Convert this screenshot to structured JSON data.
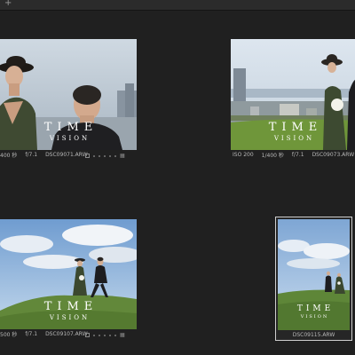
{
  "toolbar": {
    "add_icon": "plus-icon"
  },
  "watermark": {
    "title": "TIME",
    "subtitle": "VISION"
  },
  "thumbnails": [
    {
      "iso": "",
      "shutter": "400 秒",
      "aperture": "f/7.1",
      "filename": "DSC09071.ARW"
    },
    {
      "iso": "ISO 200",
      "shutter": "1/400 秒",
      "aperture": "f/7.1",
      "filename": "DSC09073.ARW"
    },
    {
      "iso": "",
      "shutter": "500 秒",
      "aperture": "f/7.1",
      "filename": "DSC09107.ARW"
    },
    {
      "iso": "",
      "shutter": "",
      "aperture": "",
      "filename": "DSC09115.ARW"
    }
  ],
  "colors": {
    "background": "#202020",
    "selection": "#cfcfcf",
    "grass": "#5a7f32",
    "sky": "#b9cfe6"
  }
}
